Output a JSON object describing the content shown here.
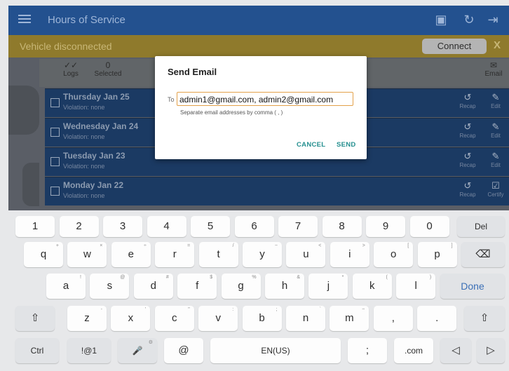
{
  "app": {
    "title": "Hours of Service",
    "appbar_icons": [
      "inspection-report-icon",
      "refresh-icon",
      "logout-icon"
    ]
  },
  "alert": {
    "text": "Vehicle disconnected",
    "connect_label": "Connect",
    "close_label": "X"
  },
  "toolbar": {
    "logs_label": "Logs",
    "selected_count": "0",
    "selected_label": "Selected",
    "email_label": "Email"
  },
  "log_rows": [
    {
      "day": "Thursday Jan 25",
      "violation": "Violation: none",
      "recap_label": "Recap",
      "action_label": "Edit"
    },
    {
      "day": "Wednesday Jan 24",
      "violation": "Violation: none",
      "recap_label": "Recap",
      "action_label": "Edit"
    },
    {
      "day": "Tuesday Jan 23",
      "violation": "Violation: none",
      "recap_label": "Recap",
      "action_label": "Edit"
    },
    {
      "day": "Monday Jan 22",
      "violation": "Violation: none",
      "recap_label": "Recap",
      "action_label": "Certify"
    }
  ],
  "dialog": {
    "title": "Send Email",
    "to_label": "To",
    "to_value": "admin1@gmail.com, admin2@gmail.com",
    "hint": "Separate email addresses by comma ( , )",
    "cancel_label": "CANCEL",
    "send_label": "SEND"
  },
  "keyboard": {
    "number_row": [
      "1",
      "2",
      "3",
      "4",
      "5",
      "6",
      "7",
      "8",
      "9",
      "0",
      "Del"
    ],
    "row1": [
      {
        "k": "q",
        "s": "+"
      },
      {
        "k": "w",
        "s": "×"
      },
      {
        "k": "e",
        "s": "÷"
      },
      {
        "k": "r",
        "s": "="
      },
      {
        "k": "t",
        "s": "/"
      },
      {
        "k": "y",
        "s": "−"
      },
      {
        "k": "u",
        "s": "<"
      },
      {
        "k": "i",
        "s": ">"
      },
      {
        "k": "o",
        "s": "["
      },
      {
        "k": "p",
        "s": "]"
      }
    ],
    "row2": [
      {
        "k": "a",
        "s": "!"
      },
      {
        "k": "s",
        "s": "@"
      },
      {
        "k": "d",
        "s": "#"
      },
      {
        "k": "f",
        "s": "$"
      },
      {
        "k": "g",
        "s": "%"
      },
      {
        "k": "h",
        "s": "&"
      },
      {
        "k": "j",
        "s": "*"
      },
      {
        "k": "k",
        "s": "("
      },
      {
        "k": "l",
        "s": ")"
      }
    ],
    "row3": [
      {
        "k": "z",
        "s": "-"
      },
      {
        "k": "x",
        "s": "'"
      },
      {
        "k": "c",
        "s": "\""
      },
      {
        "k": "v",
        "s": ":"
      },
      {
        "k": "b",
        "s": ";"
      },
      {
        "k": "n",
        "s": "`"
      },
      {
        "k": "m",
        "s": "~"
      },
      {
        "k": ",",
        "s": ""
      },
      {
        "k": ".",
        "s": ""
      }
    ],
    "backspace_symbol": "⌫",
    "done_label": "Done",
    "shift_symbol": "⇧",
    "ctrl_label": "Ctrl",
    "symbols_label": "!@1",
    "mic_symbol": "🎤",
    "at_label": "@",
    "language_label": "EN(US)",
    "semicolon_label": ";",
    "com_label": ".com",
    "left_arrow": "◁",
    "right_arrow": "▷"
  },
  "colors": {
    "appbar": "#23518f",
    "alert": "#8f7a2c",
    "row": "#1b3a63",
    "dialog_accent": "#248f8f",
    "field_focus": "#e3a14a",
    "done_text": "#3b6fb6"
  }
}
